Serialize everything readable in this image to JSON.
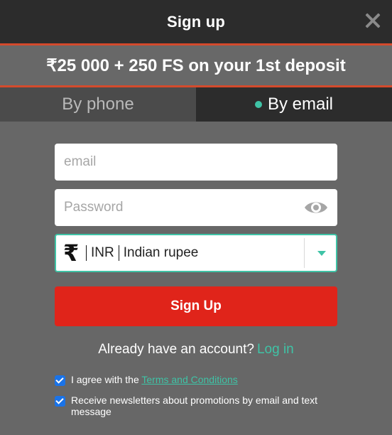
{
  "header": {
    "title": "Sign up",
    "close_icon": "close-icon"
  },
  "promo": {
    "text": "₹25 000 + 250 FS on your 1st deposit"
  },
  "tabs": [
    {
      "label": "By phone",
      "active": false
    },
    {
      "label": "By email",
      "active": true
    }
  ],
  "form": {
    "email_placeholder": "email",
    "password_placeholder": "Password",
    "password_icon": "eye-icon",
    "currency": {
      "symbol": "₹",
      "code": "INR",
      "name": "Indian rupee"
    },
    "submit_label": "Sign Up"
  },
  "account": {
    "prompt": "Already have an account?",
    "login_label": "Log in"
  },
  "agree": {
    "prefix": "I agree with the",
    "terms_link": "Terms and Conditions",
    "checked": true
  },
  "newsletter": {
    "text": "Receive newsletters about promotions by email and text message",
    "checked": true
  },
  "colors": {
    "accent": "#3fc3a6",
    "button": "#e0241a",
    "promo_border": "#d44a2c",
    "header_bg": "#2c2c2c",
    "body_bg": "#676767"
  }
}
